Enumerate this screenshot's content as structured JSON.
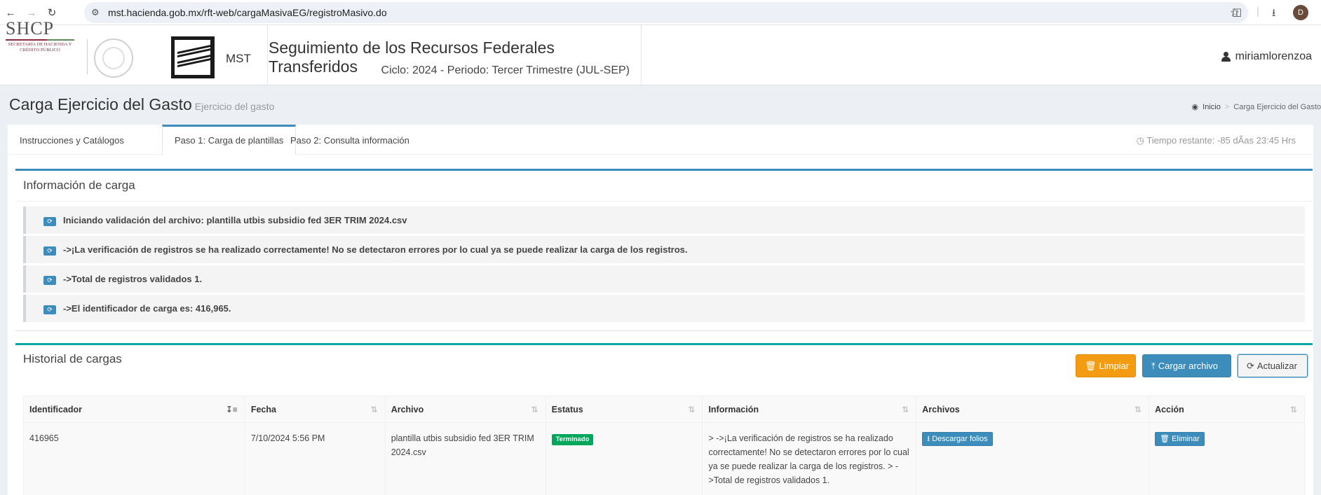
{
  "browser": {
    "url": "mst.hacienda.gob.mx/rft-web/cargaMasivaEG/registroMasivo.do",
    "profile_initial": "D"
  },
  "header": {
    "logo_text": "SHCP",
    "logo_subtext": "SECRETARÍA DE HACIENDA Y CRÉDITO PÚBLICO",
    "mst_label": "MST",
    "title": "Seguimiento de los Recursos Federales Transferidos",
    "subtitle": "Ciclo: 2024 - Periodo: Tercer Trimestre (JUL-SEP)",
    "username": "miriamlorenzoa"
  },
  "page": {
    "title": "Carga Ejercicio del Gasto",
    "subtitle": "Ejercicio del gasto",
    "breadcrumb": [
      "Inicio",
      "Carga Ejercicio del Gasto"
    ]
  },
  "tabs": [
    {
      "label": "Instrucciones y Catálogos"
    },
    {
      "label": "Paso 1: Carga de plantillas"
    },
    {
      "label": "Paso 2: Consulta información"
    }
  ],
  "timer": "Tiempo restante: -85 dÃas 23:45 Hrs",
  "info_box": {
    "title": "Información de carga",
    "messages": [
      "Iniciando validación del archivo: plantilla utbis subsidio fed 3ER TRIM 2024.csv",
      "->¡La verificación de registros se ha realizado correctamente! No se detectaron errores por lo cual ya se puede realizar la carga de los registros.",
      "->Total de registros validados 1.",
      "->El identificador de carga es: 416,965."
    ]
  },
  "history_box": {
    "title": "Historial de cargas",
    "buttons": {
      "clear": "Limpiar",
      "upload": "Cargar archivo",
      "refresh": "Actualizar"
    },
    "columns": [
      "Identificador",
      "Fecha",
      "Archivo",
      "Estatus",
      "Información",
      "Archivos",
      "Acción"
    ],
    "rows": [
      {
        "id": "416965",
        "date": "7/10/2024 5:56 PM",
        "file": "plantilla utbis subsidio fed 3ER TRIM 2024.csv",
        "status": "Terminado",
        "info": "> ->¡La verificación de registros se ha realizado correctamente! No se detectaron errores por lo cual ya se puede realizar la carga de los registros. > ->Total de registros validados 1.",
        "download_label": "Descargar folios",
        "delete_label": "Eliminar"
      }
    ]
  },
  "colors": {
    "primary": "#3c8dbc",
    "warning": "#f39c12",
    "success": "#00a65a",
    "teal": "#00a7a5"
  }
}
